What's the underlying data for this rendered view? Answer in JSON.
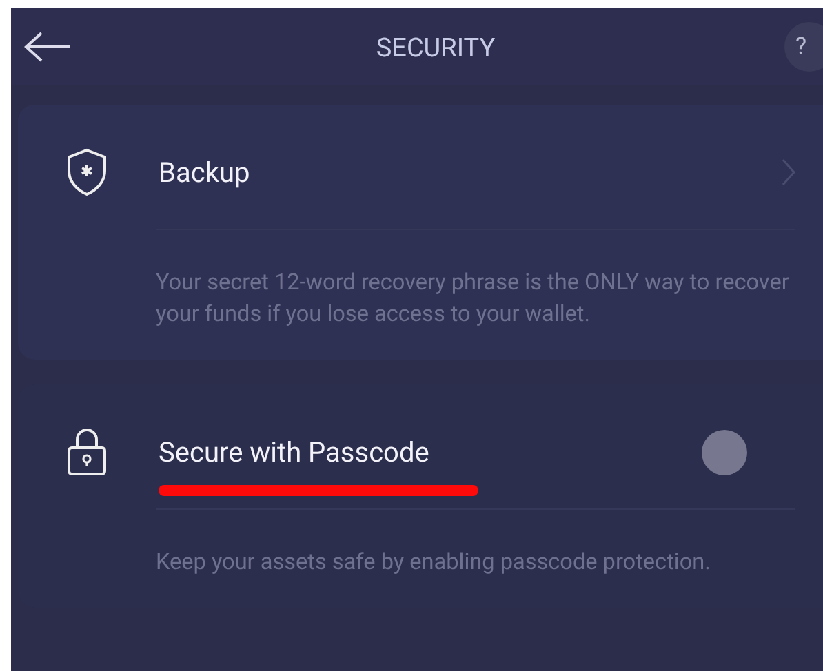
{
  "header": {
    "title": "SECURITY",
    "help": "?"
  },
  "settings": [
    {
      "kind": "link",
      "title": "Backup",
      "description": "Your secret 12-word recovery phrase is the ONLY way to recover your funds if you lose access to your wallet."
    },
    {
      "kind": "toggle",
      "title": "Secure with Passcode",
      "on": false,
      "description": "Keep your assets safe by enabling passcode protection."
    }
  ]
}
